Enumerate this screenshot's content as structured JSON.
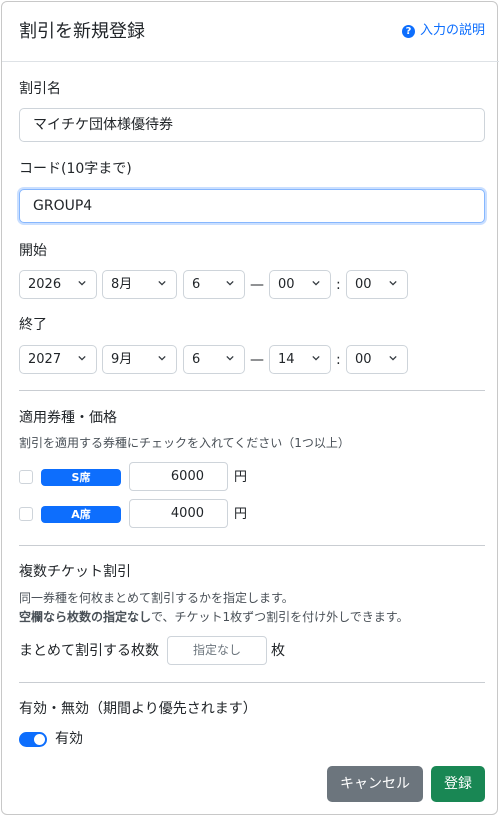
{
  "dialog": {
    "title": "割引を新規登録",
    "help_link": "入力の説明",
    "help_icon_glyph": "?"
  },
  "discount_name": {
    "label": "割引名",
    "value": "マイチケ団体様優待券"
  },
  "code": {
    "label": "コード(10字まで)",
    "value": "GROUP4"
  },
  "start": {
    "label": "開始",
    "year": "2026",
    "month": "8月",
    "day": "6",
    "hour": "00",
    "minute": "00",
    "dash": "—",
    "colon": ":"
  },
  "end": {
    "label": "終了",
    "year": "2027",
    "month": "9月",
    "day": "6",
    "hour": "14",
    "minute": "00",
    "dash": "—",
    "colon": ":"
  },
  "ticket_types": {
    "heading": "適用券種・価格",
    "instruction": "割引を適用する券種にチェックを入れてください（1つ以上）",
    "items": [
      {
        "badge": "S席",
        "price": "6000",
        "unit": "円",
        "checked": false
      },
      {
        "badge": "A席",
        "price": "4000",
        "unit": "円",
        "checked": false
      }
    ]
  },
  "multi_ticket": {
    "heading": "複数チケット割引",
    "desc_line1": "同一券種を何枚まとめて割引するかを指定します。",
    "desc_line2_bold": "空欄なら枚数の指定なし",
    "desc_line2_rest": "で、チケット1枚ずつ割引を付け外しできます。",
    "count_label": "まとめて割引する枚数",
    "count_placeholder": "指定なし",
    "count_unit": "枚"
  },
  "status": {
    "heading": "有効・無効（期間より優先されます）",
    "toggle_label": "有効",
    "enabled": true
  },
  "buttons": {
    "cancel": "キャンセル",
    "submit": "登録"
  },
  "colors": {
    "primary": "#0d6efd",
    "secondary": "#6c757d",
    "success": "#198754",
    "border": "#ced4da"
  },
  "icons": {
    "help": "question-circle-icon",
    "select_caret": "chevron-down-icon",
    "toggle": "switch-on-icon"
  }
}
